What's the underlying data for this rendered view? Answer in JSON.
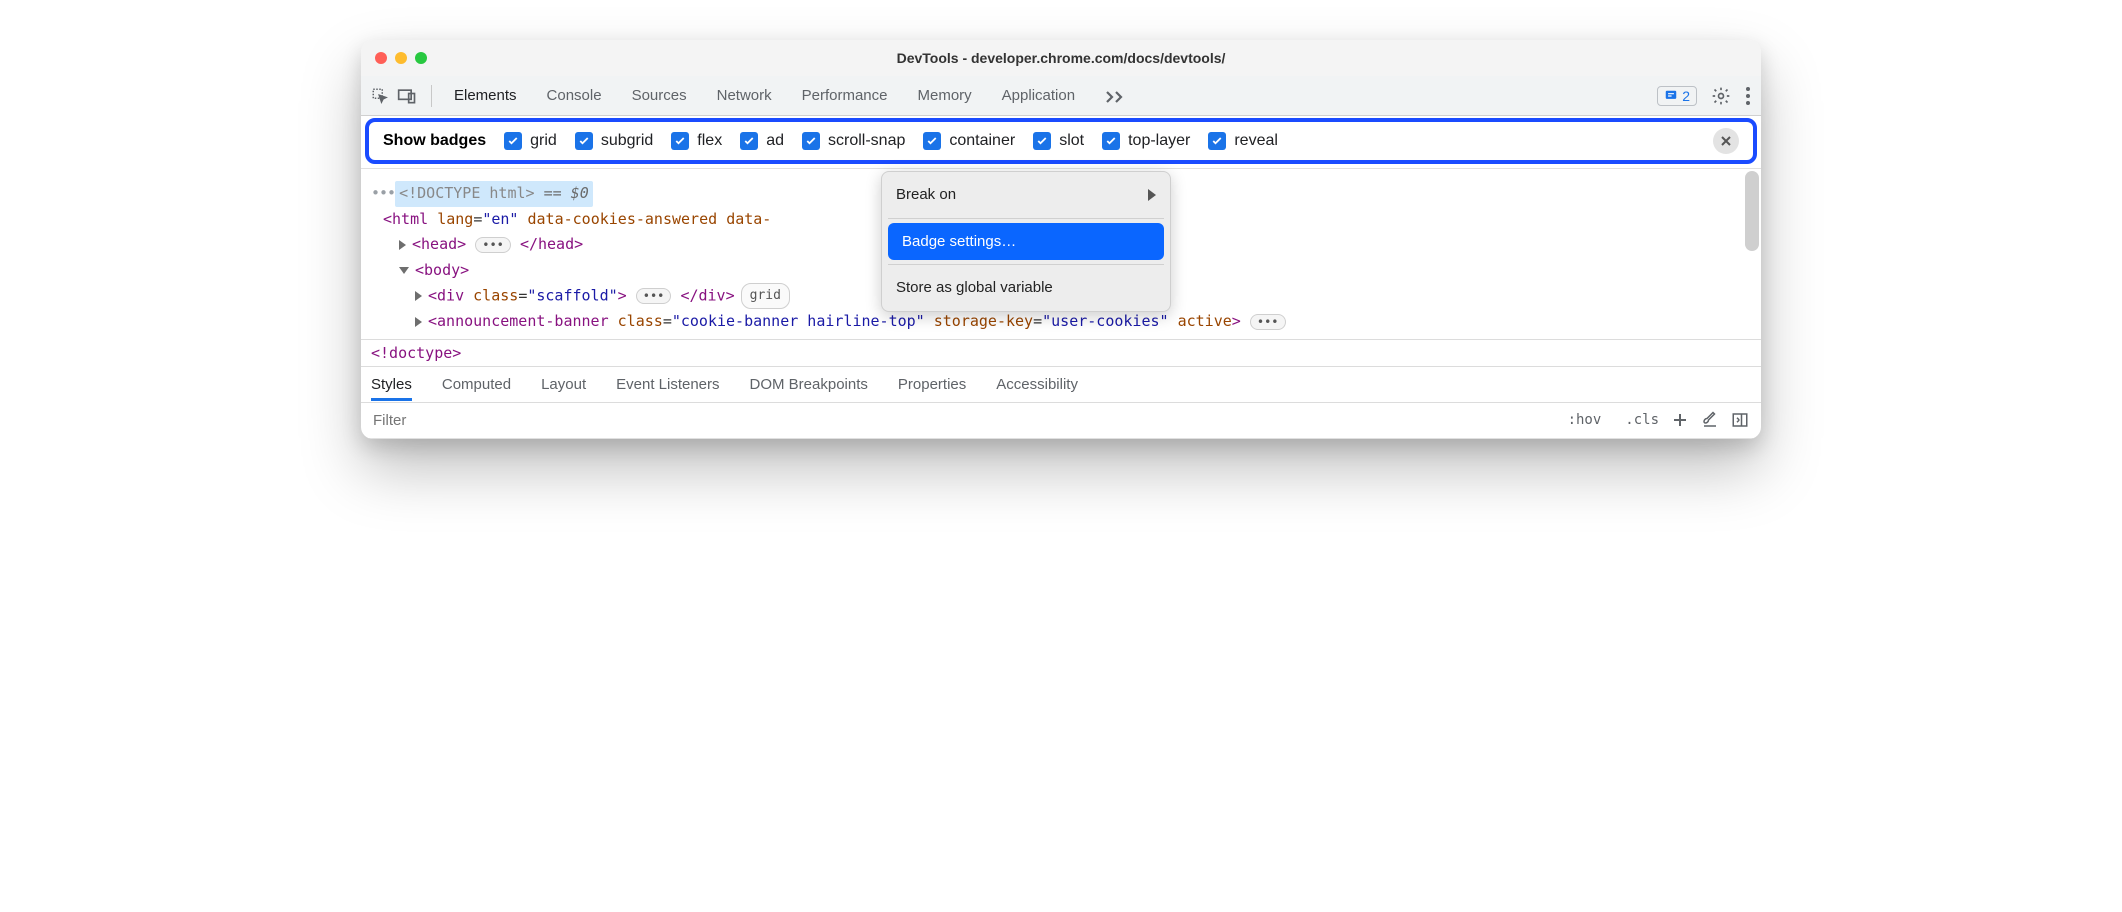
{
  "window": {
    "title": "DevTools - developer.chrome.com/docs/devtools/"
  },
  "toolbar": {
    "tabs": [
      "Elements",
      "Console",
      "Sources",
      "Network",
      "Performance",
      "Memory",
      "Application"
    ],
    "active_tab": "Elements",
    "issues_count": "2"
  },
  "badgebar": {
    "label": "Show badges",
    "items": [
      "grid",
      "subgrid",
      "flex",
      "ad",
      "scroll-snap",
      "container",
      "slot",
      "top-layer",
      "reveal"
    ]
  },
  "dom": {
    "doctype": "<!DOCTYPE html>",
    "selected_suffix": " == $0",
    "html_open": {
      "tag": "html",
      "attrs": [
        [
          "lang",
          "en"
        ],
        [
          "data-cookies-answered",
          ""
        ],
        [
          "data-",
          ""
        ]
      ]
    },
    "head": {
      "tag": "head"
    },
    "body": {
      "tag": "body"
    },
    "scaffold": {
      "tag": "div",
      "attrs": [
        [
          "class",
          "scaffold"
        ]
      ],
      "badge": "grid"
    },
    "banner": {
      "tag": "announcement-banner",
      "attrs": [
        [
          "class",
          "cookie-banner hairline-top"
        ],
        [
          "storage-key",
          "user-cookies"
        ],
        [
          "active",
          ""
        ]
      ]
    }
  },
  "context_menu": {
    "items": [
      "Break on",
      "Badge settings…",
      "Store as global variable"
    ],
    "has_submenu": [
      true,
      false,
      false
    ],
    "highlighted_index": 1
  },
  "breadcrumb": "<!doctype>",
  "subtabs": [
    "Styles",
    "Computed",
    "Layout",
    "Event Listeners",
    "DOM Breakpoints",
    "Properties",
    "Accessibility"
  ],
  "subtabs_active": "Styles",
  "filter": {
    "placeholder": "Filter",
    "hov": ":hov",
    "cls": ".cls"
  }
}
